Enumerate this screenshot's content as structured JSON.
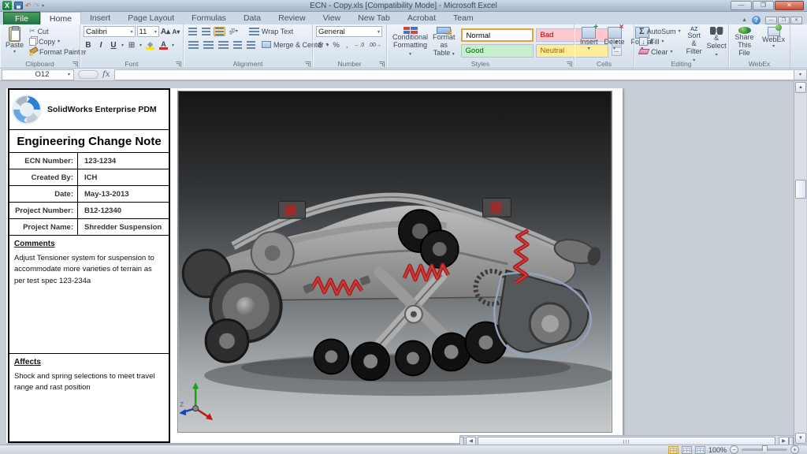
{
  "window": {
    "title": "ECN - Copy.xls  [Compatibility Mode] - Microsoft Excel"
  },
  "icons": {
    "excel_logo": "X",
    "dropdown": "▾",
    "undo": "↶",
    "redo": "↷",
    "minimize": "—",
    "restore": "❐",
    "close": "✕",
    "ribbon_collapse": "▲",
    "help": "?",
    "cut": "✂",
    "bold": "B",
    "italic": "I",
    "underline": "U",
    "borders": "⊞",
    "fill_color": "◈",
    "font_color": "A",
    "grow_font": "A▴",
    "shrink_font": "A▾",
    "orientation": "ab",
    "dollar": "$",
    "percent": "%",
    "comma": ",",
    "inc_decimal": "←.0",
    "dec_decimal": ".00→",
    "sigma": "Σ",
    "fill_arrow": "↓",
    "sort_az": "AZ",
    "scroll_up": "▲",
    "scroll_down": "▼",
    "axis_z": "Z"
  },
  "ribbon": {
    "tabs": [
      {
        "label": "File"
      },
      {
        "label": "Home"
      },
      {
        "label": "Insert"
      },
      {
        "label": "Page Layout"
      },
      {
        "label": "Formulas"
      },
      {
        "label": "Data"
      },
      {
        "label": "Review"
      },
      {
        "label": "View"
      },
      {
        "label": "New Tab"
      },
      {
        "label": "Acrobat"
      },
      {
        "label": "Team"
      }
    ],
    "clipboard": {
      "group": "Clipboard",
      "paste": "Paste",
      "cut": "Cut",
      "copy": "Copy",
      "format_painter": "Format Painter"
    },
    "font": {
      "group": "Font",
      "family": "Calibri",
      "size": "11"
    },
    "alignment": {
      "group": "Alignment",
      "wrap_text": "Wrap Text",
      "merge_center": "Merge & Center"
    },
    "number": {
      "group": "Number",
      "format": "General"
    },
    "styles": {
      "group": "Styles",
      "conditional_1": "Conditional",
      "conditional_2": "Formatting",
      "format_table_1": "Format",
      "format_table_2": "as Table",
      "swatches": [
        {
          "label": "Normal"
        },
        {
          "label": "Bad"
        },
        {
          "label": "Good"
        },
        {
          "label": "Neutral"
        }
      ]
    },
    "cells": {
      "group": "Cells",
      "insert": "Insert",
      "delete": "Delete",
      "format": "Format"
    },
    "editing": {
      "group": "Editing",
      "autosum": "AutoSum",
      "fill": "Fill",
      "clear": "Clear",
      "sort_filter_1": "Sort &",
      "sort_filter_2": "Filter",
      "find_select_1": "Find &",
      "find_select_2": "Select"
    },
    "webex": {
      "group": "WebEx",
      "share_1": "Share",
      "share_2": "This File",
      "webex": "WebEx"
    }
  },
  "formula_bar": {
    "name_box": "O12",
    "fx": "fx"
  },
  "document": {
    "brand": "SolidWorks Enterprise PDM",
    "title": "Engineering Change Note",
    "fields": [
      {
        "label": "ECN Number:",
        "value": "123-1234"
      },
      {
        "label": "Created By:",
        "value": "ICH"
      },
      {
        "label": "Date:",
        "value": "May-13-2013"
      },
      {
        "label": "Project Number:",
        "value": "B12-12340"
      },
      {
        "label": "Project Name:",
        "value": "Shredder Suspension"
      }
    ],
    "comments_heading": "Comments",
    "comments_text": "Adjust Tensioner system for suspension to accommodate more varieties of terrain as per test spec 123-234a",
    "affects_heading": "Affects",
    "affects_text": "Shock and spring selections to meet travel range and rast position"
  },
  "status_bar": {
    "zoom_level": "100%"
  }
}
